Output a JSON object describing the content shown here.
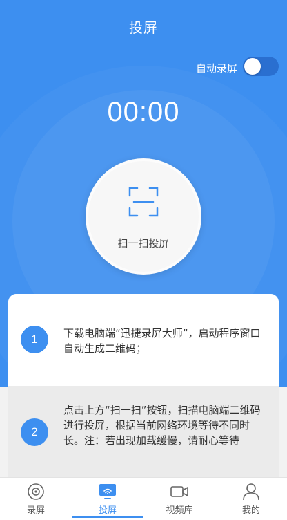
{
  "header": {
    "title": "投屏"
  },
  "auto_record": {
    "label": "自动录屏",
    "enabled": false
  },
  "timer": "00:00",
  "scan": {
    "label": "扫一扫投屏"
  },
  "steps": [
    {
      "number": "1",
      "text": "下载电脑端“迅捷录屏大师”，启动程序窗口自动生成二维码；"
    },
    {
      "number": "2",
      "text": "点击上方“扫一扫”按钮，扫描电脑端二维码进行投屏，根据当前网络环境等待不同时长。注：若出现加载缓慢，请耐心等待"
    }
  ],
  "tabs": [
    {
      "label": "录屏",
      "icon": "record-circle-icon"
    },
    {
      "label": "投屏",
      "icon": "cast-screen-icon",
      "active": true
    },
    {
      "label": "视频库",
      "icon": "video-camera-icon"
    },
    {
      "label": "我的",
      "icon": "person-icon"
    }
  ],
  "colors": {
    "accent": "#3d8ff0",
    "background": "#f2f2f2"
  }
}
